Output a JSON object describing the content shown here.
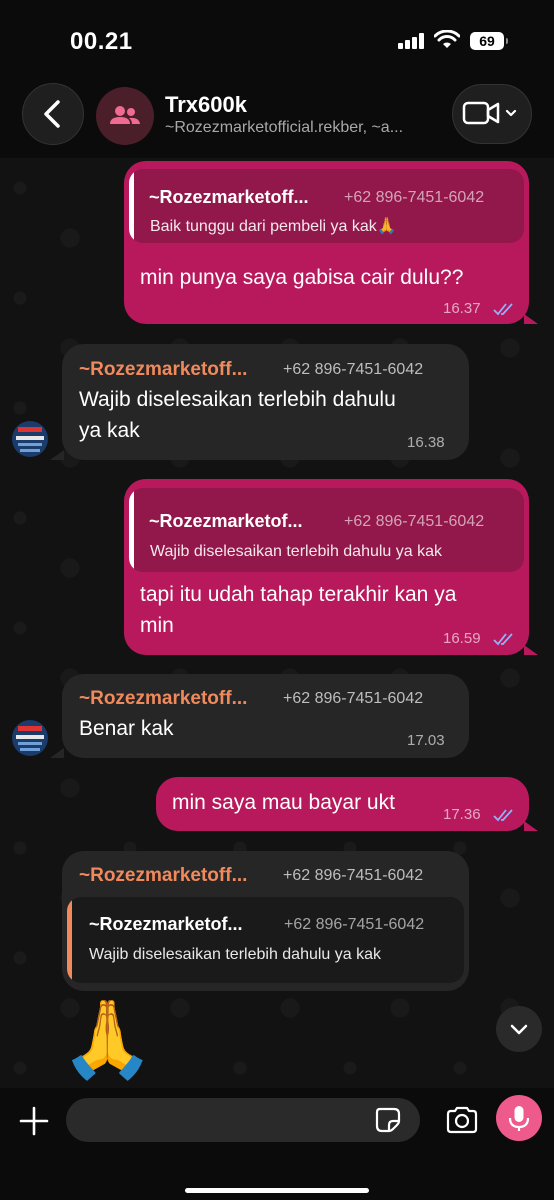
{
  "status_bar": {
    "time": "00.21",
    "battery": "69"
  },
  "header": {
    "title": "Trx600k",
    "subtitle": "~Rozezmarketofficial.rekber, ~a..."
  },
  "messages": [
    {
      "direction": "out",
      "quote": {
        "sender": "~Rozezmarketoff...",
        "phone": "+62 896-7451-6042",
        "text": "Baik tunggu dari pembeli ya kak🙏"
      },
      "text": "min punya saya gabisa cair dulu??",
      "time": "16.37",
      "status": "read"
    },
    {
      "direction": "in",
      "sender": "~Rozezmarketoff...",
      "phone": "+62 896-7451-6042",
      "text_lines": [
        "Wajib diselesaikan terlebih dahulu",
        "ya kak"
      ],
      "time": "16.38"
    },
    {
      "direction": "out",
      "quote": {
        "sender": "~Rozezmarketof...",
        "phone": "+62 896-7451-6042",
        "text": "Wajib diselesaikan terlebih dahulu ya kak"
      },
      "text_lines": [
        "tapi itu udah tahap terakhir kan ya",
        "min"
      ],
      "time": "16.59",
      "status": "read"
    },
    {
      "direction": "in",
      "sender": "~Rozezmarketoff...",
      "phone": "+62 896-7451-6042",
      "text": "Benar kak",
      "time": "17.03"
    },
    {
      "direction": "out",
      "text": "min saya mau bayar ukt",
      "time": "17.36",
      "status": "read"
    },
    {
      "direction": "in",
      "sender": "~Rozezmarketoff...",
      "phone": "+62 896-7451-6042",
      "quote": {
        "sender": "~Rozezmarketof...",
        "phone": "+62 896-7451-6042",
        "text": "Wajib diselesaikan terlebih dahulu ya kak"
      }
    },
    {
      "direction": "in",
      "emoji": "🙏"
    }
  ],
  "input": {
    "value": "",
    "placeholder": ""
  },
  "colors": {
    "outgoing_bubble": "#b8195c",
    "incoming_bubble": "#262626",
    "sender_name": "#f08a5d",
    "read_ticks": "#8fb3ff",
    "mic_button": "#ef5a8c"
  },
  "icons": {
    "back": "chevron-left-icon",
    "group_avatar": "group-people-icon",
    "video_call": "video-camera-icon",
    "attach": "plus-icon",
    "sticker": "sticker-icon",
    "camera": "camera-icon",
    "mic": "microphone-icon",
    "scroll_down": "chevron-down-icon",
    "read_status": "double-check-icon"
  }
}
